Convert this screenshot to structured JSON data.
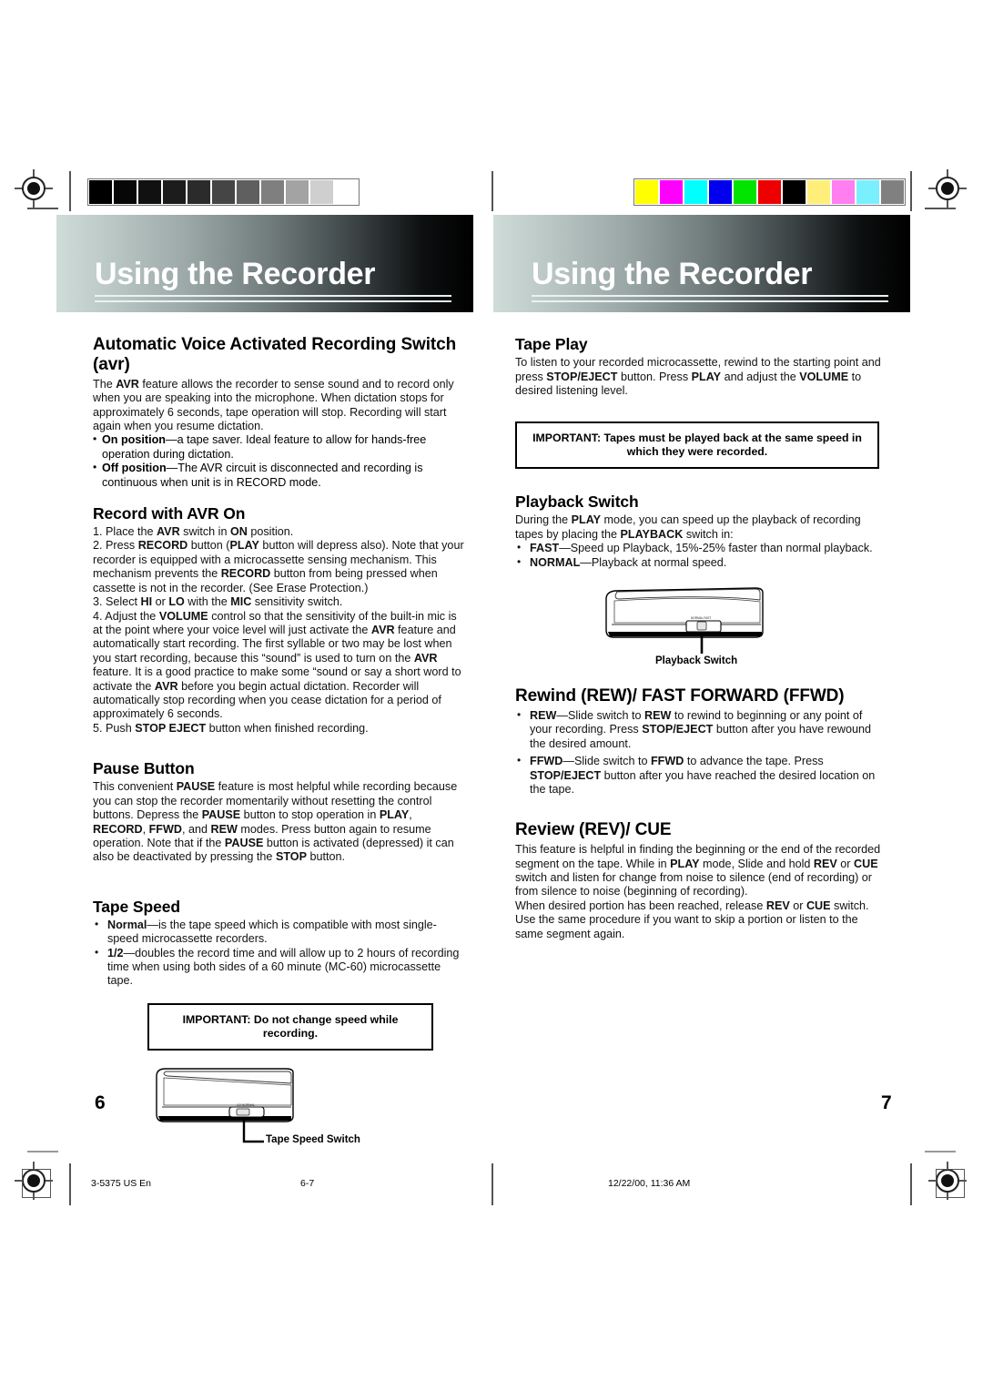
{
  "document": {
    "banner_title_left": "Using the Recorder",
    "banner_title_right": "Using the Recorder",
    "page_number_left": "6",
    "page_number_right": "7"
  },
  "calibration": {
    "grayscale_swatches": [
      "#000000",
      "#070707",
      "#111111",
      "#1c1c1c",
      "#2b2b2b",
      "#454545",
      "#5f5f5f",
      "#7f7f7f",
      "#a3a3a3",
      "#cfcfcf",
      "#ffffff"
    ],
    "color_swatches": [
      "#ffff00",
      "#ff00ff",
      "#00ffff",
      "#0000ee",
      "#00e400",
      "#ee0000",
      "#000000",
      "#ffef7a",
      "#ff7ef0",
      "#7af0ff",
      "#808080"
    ]
  },
  "left_page": {
    "sections": [
      {
        "id": "avr",
        "heading": "Automatic Voice Activated Recording Switch (avr)",
        "paragraphs": [
          "The AVR feature allows the recorder to sense sound and to record only when you are speaking into the microphone. When dictation stops for approximately 6 seconds, tape operation will stop. Recording will start again when you resume dictation."
        ],
        "bullets": [
          {
            "term": "On position",
            "text": "—a tape saver. Ideal feature to allow for hands-free operation during dictation."
          },
          {
            "term": "Off position",
            "text": "—The AVR circuit is disconnected and recording is continuous when unit is in RECORD mode."
          }
        ]
      },
      {
        "id": "record-with-avr-on",
        "heading": "Record with AVR On",
        "steps": [
          "1. Place the AVR switch in ON position.",
          "2. Press RECORD button (PLAY button will depress also). Note that your recorder is equipped with a microcassette sensing mechanism. This mechanism prevents the RECORD button from being pressed when cassette is not in the recorder. (See Erase Protection.)",
          "3. Select HI or LO with the MIC sensitivity switch.",
          "4. Adjust the VOLUME control so that the sensitivity of the built-in  mic is at the point where your voice level will just activate the AVR feature and automatically start recording. The first syllable or two may be lost when you start recording, because this “sound” is used to turn on the AVR feature. It is a good practice to make some “sound or say a short word to activate the AVR before you begin actual dictation. Recorder will automatically stop recording when you cease dictation for a period of approximately 6 seconds.",
          "5. Push STOP EJECT button when finished recording."
        ]
      },
      {
        "id": "pause-button",
        "heading": "Pause Button",
        "paragraphs": [
          "This convenient PAUSE feature is most helpful while recording because you can stop the recorder momentarily without resetting the control buttons. Depress the PAUSE button to stop operation in PLAY, RECORD, FFWD, and REW modes. Press button again to resume operation. Note that if the PAUSE button is activated (depressed) it can also be deactivated by pressing the STOP button."
        ]
      },
      {
        "id": "tape-speed",
        "heading": "Tape Speed",
        "bullets": [
          {
            "term": "Normal",
            "text": "—is the tape speed which is compatible with most single-speed microcassette recorders."
          },
          {
            "term": "1/2",
            "text": "—doubles the record time and will allow up to 2 hours of recording time when using both sides of a 60 minute (MC-60) microcassette tape."
          }
        ]
      }
    ],
    "important_box": "IMPORTANT: Do not change speed while recording.",
    "illustration_callout": "Tape Speed Switch"
  },
  "right_page": {
    "sections": [
      {
        "id": "tape-play",
        "heading": "Tape Play",
        "paragraphs": [
          "To listen to your recorded microcassette, rewind to the starting point and press STOP/EJECT button. Press PLAY and adjust the VOLUME to desired listening level."
        ]
      },
      {
        "id": "playback-switch",
        "heading": "Playback Switch",
        "paragraphs": [
          "During the PLAY mode, you can speed up the playback of recording tapes by placing the PLAYBACK switch in:"
        ],
        "bullets": [
          {
            "term": "FAST",
            "text": "—Speed up Playback, 15%-25% faster than normal playback."
          },
          {
            "term": "NORMAL",
            "text": "—Playback at normal speed."
          }
        ]
      },
      {
        "id": "rewind-ffwd",
        "heading": "Rewind (REW)/ FAST FORWARD (FFWD)",
        "bullets": [
          {
            "term": "REW",
            "text": "—Slide switch to REW to rewind to beginning or any point of your recording. Press STOP/EJECT button after you have rewound the desired amount."
          },
          {
            "term": "FFWD",
            "text": "—Slide switch to FFWD to advance the tape. Press STOP/EJECT button after you have reached the desired location on the tape."
          }
        ]
      },
      {
        "id": "review-cue",
        "heading": "Review (REV)/ CUE",
        "paragraphs": [
          "This feature is helpful in finding the beginning or the end of the recorded segment on the tape. While in PLAY mode, Slide and hold REV or CUE switch and listen for change from noise to silence (end of recording) or from silence to noise (beginning of recording).",
          "When desired portion has been reached, release REV or CUE switch.",
          "Use the same procedure if you want to skip a portion or listen to the same segment again."
        ]
      }
    ],
    "important_box_line1": "IMPORTANT: Tapes must be played back at the same speed in which",
    "important_box_line2": "they were recorded.",
    "illustration_callout": "Playback Switch"
  },
  "footer": {
    "doc_code": "3-5375 US En",
    "page_range": "6-7",
    "timestamp": "12/22/00, 11:36 AM"
  }
}
